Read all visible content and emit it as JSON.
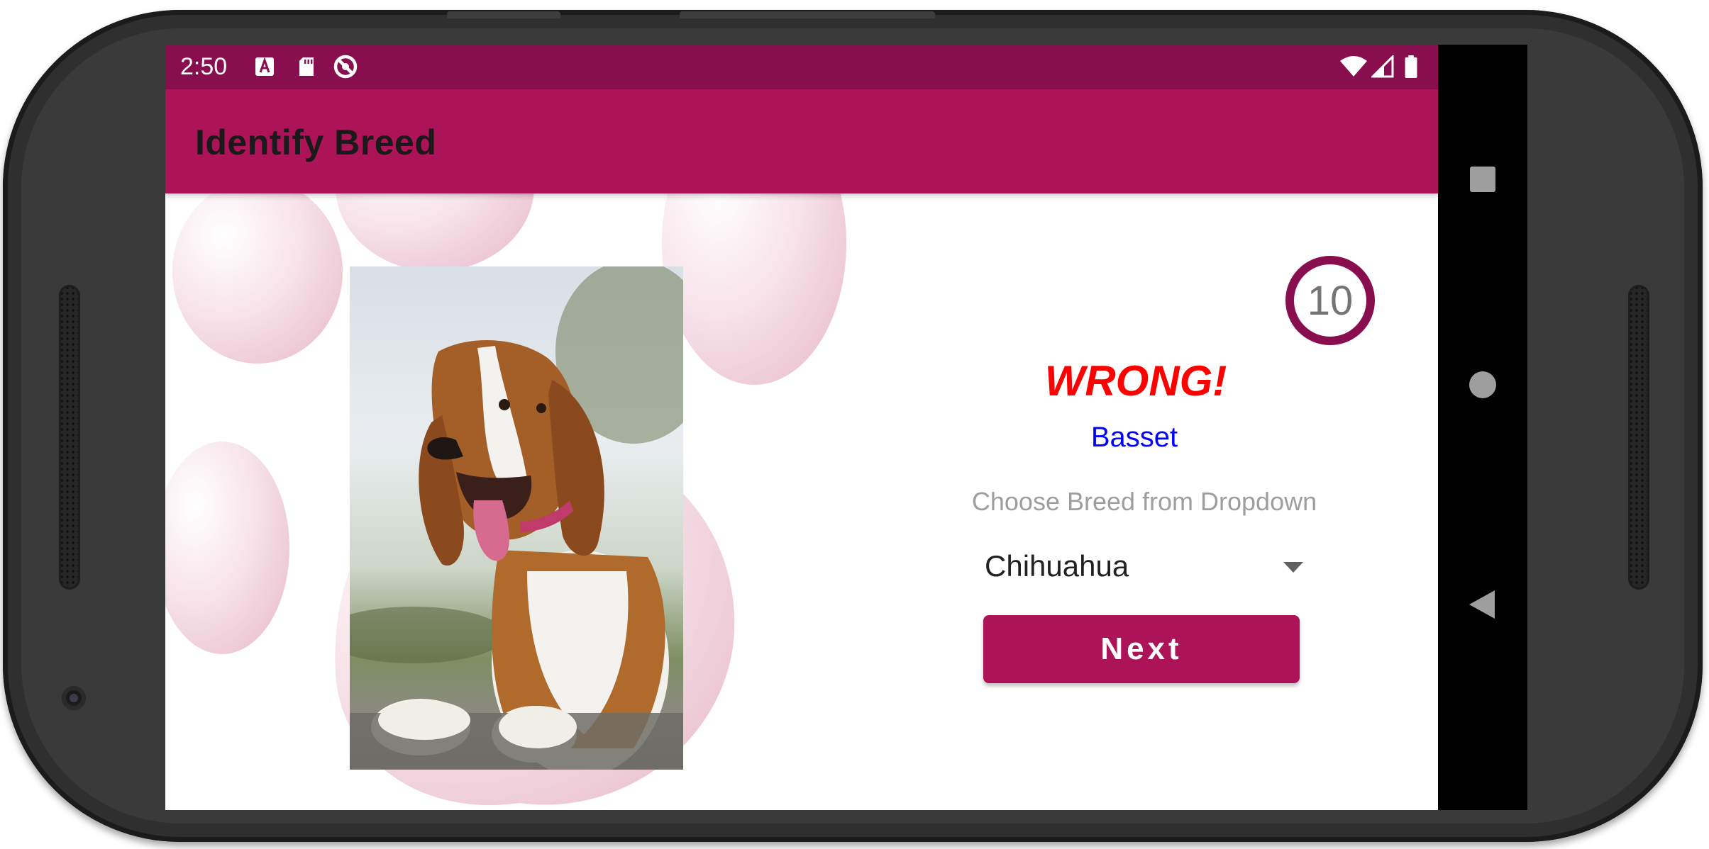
{
  "status_bar": {
    "time": "2:50",
    "left_icons": [
      "text-a-icon",
      "sd-card-icon",
      "sync-blocked-icon"
    ],
    "right_icons": [
      "wifi-icon",
      "cellular-icon",
      "battery-icon"
    ]
  },
  "app_bar": {
    "title": "Identify Breed"
  },
  "quiz": {
    "timer": "10",
    "result": "WRONG!",
    "correct_breed": "Basset",
    "hint": "Choose Breed from Dropdown",
    "selected_breed": "Chihuahua",
    "next_label": "Next"
  },
  "nav_bar": {
    "buttons": [
      "recents-icon",
      "home-icon",
      "back-icon"
    ]
  },
  "colors": {
    "primary": "#ad1457",
    "primary_dark": "#880e4f",
    "wrong": "#ff0000",
    "answer": "#0000ff"
  }
}
